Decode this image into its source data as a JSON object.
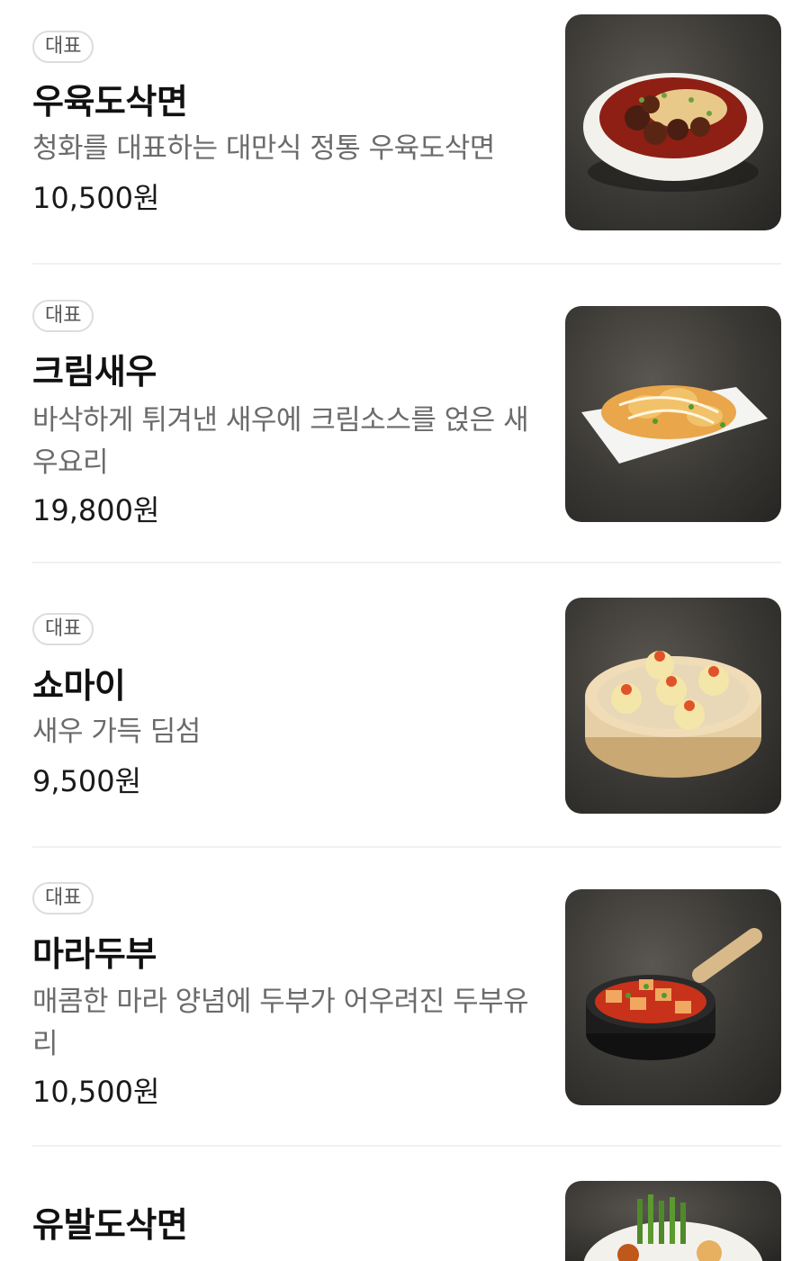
{
  "items": [
    {
      "badge": "대표",
      "name": "우육도삭면",
      "desc": "청화를 대표하는 대만식 정통 우육도삭면",
      "price": "10,500원",
      "image_icon": "beef-noodle-soup-photo"
    },
    {
      "badge": "대표",
      "name": "크림새우",
      "desc": "바삭하게 튀겨낸 새우에 크림소스를 얹은 새우요리",
      "price": "19,800원",
      "image_icon": "cream-shrimp-photo"
    },
    {
      "badge": "대표",
      "name": "쇼마이",
      "desc": "새우 가득 딤섬",
      "price": "9,500원",
      "image_icon": "shumai-dumpling-photo"
    },
    {
      "badge": "대표",
      "name": "마라두부",
      "desc": "매콤한 마라 양념에 두부가 어우려진 두부유리",
      "price": "10,500원",
      "image_icon": "mala-tofu-photo"
    },
    {
      "name": "유발도삭면",
      "image_icon": "noodle-dish-photo"
    }
  ],
  "colors": {
    "badge_border": "#dcdcdc",
    "desc_text": "#6b6b6b",
    "divider": "#f1f1f1"
  }
}
